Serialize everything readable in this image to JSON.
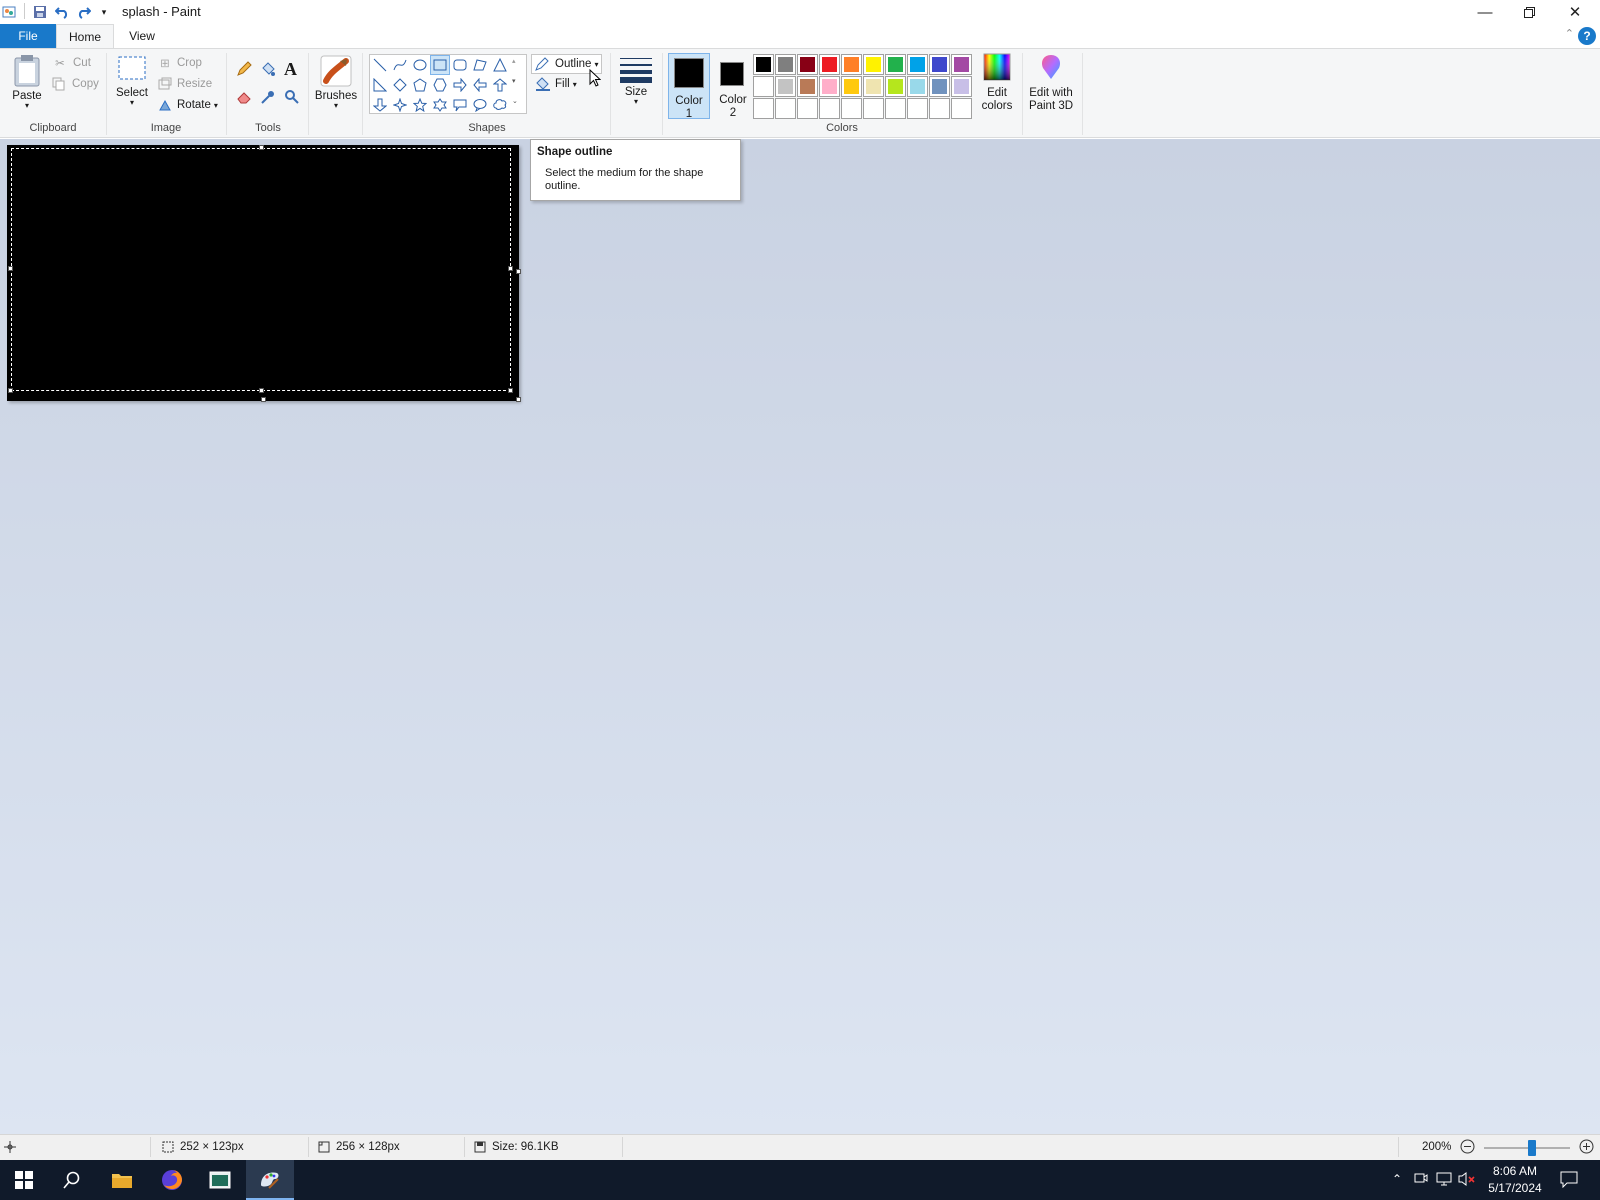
{
  "window": {
    "title": "splash - Paint"
  },
  "tabs": {
    "file": "File",
    "home": "Home",
    "view": "View"
  },
  "clipboard": {
    "paste": "Paste",
    "cut": "Cut",
    "copy": "Copy",
    "group": "Clipboard"
  },
  "image": {
    "select": "Select",
    "crop": "Crop",
    "resize": "Resize",
    "rotate": "Rotate",
    "group": "Image"
  },
  "tools": {
    "group": "Tools"
  },
  "brushes": {
    "label": "Brushes"
  },
  "shapes": {
    "outline": "Outline",
    "fill": "Fill",
    "group": "Shapes"
  },
  "size": {
    "label": "Size"
  },
  "colors": {
    "color1_line1": "Color",
    "color1_line2": "1",
    "color2_line1": "Color",
    "color2_line2": "2",
    "edit_line1": "Edit",
    "edit_line2": "colors",
    "paint3d_line1": "Edit with",
    "paint3d_line2": "Paint 3D",
    "group": "Colors",
    "color1_value": "#000000",
    "color2_value": "#000000",
    "row1": [
      "#000000",
      "#7f7f7f",
      "#880015",
      "#ed1c24",
      "#ff7f27",
      "#fff200",
      "#22b14c",
      "#00a2e8",
      "#3f48cc",
      "#a349a4"
    ],
    "row2": [
      "#ffffff",
      "#c3c3c3",
      "#b97a57",
      "#ffaec9",
      "#ffc90e",
      "#efe4b0",
      "#b5e61d",
      "#99d9ea",
      "#7092be",
      "#c8bfe7"
    ]
  },
  "tooltip": {
    "title": "Shape outline",
    "body": "Select the medium for the shape outline."
  },
  "status": {
    "selection_size": "252 × 123px",
    "image_size": "256 × 128px",
    "file_size": "Size: 96.1KB",
    "zoom": "200%"
  },
  "taskbar": {
    "time": "8:06 AM",
    "date": "5/17/2024"
  }
}
